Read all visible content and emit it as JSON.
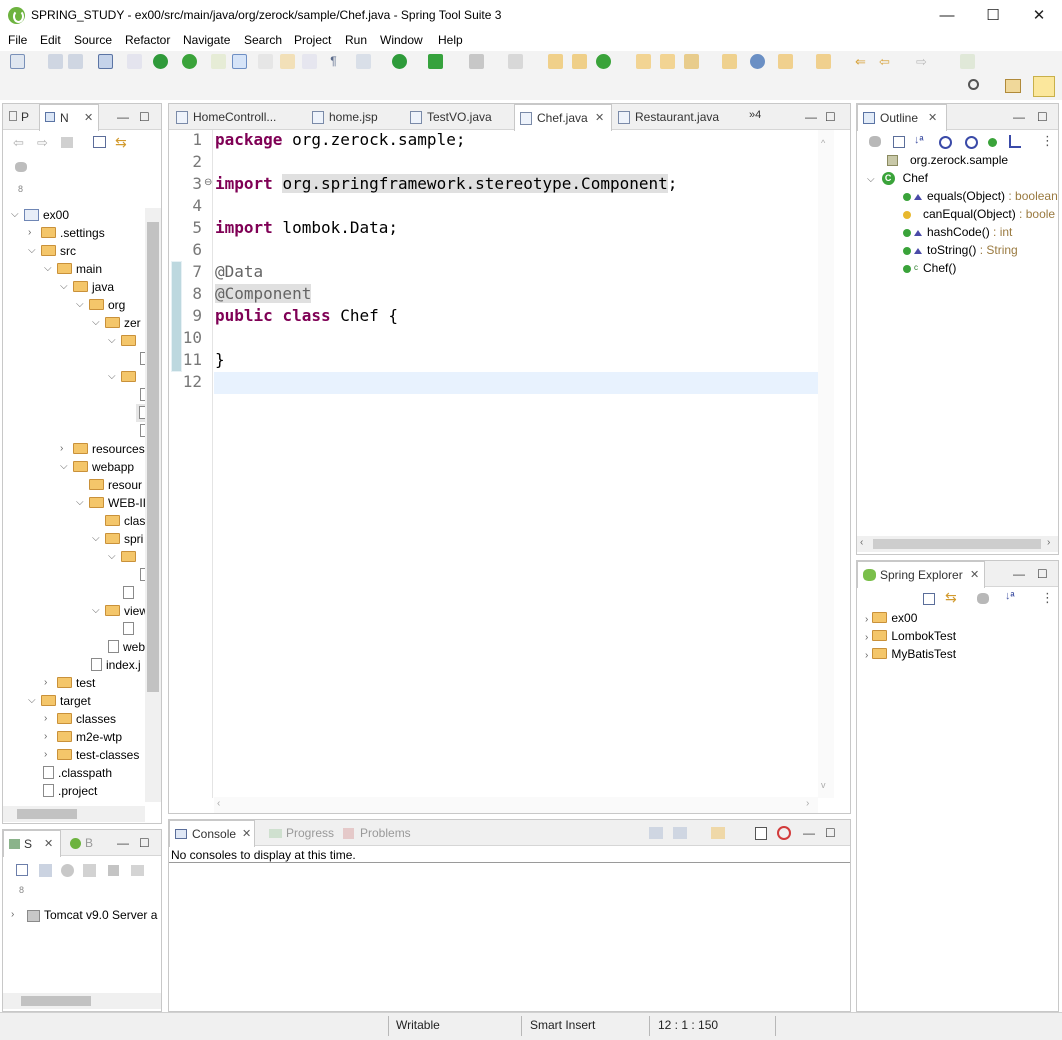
{
  "window": {
    "title": "SPRING_STUDY - ex00/src/main/java/org/zerock/sample/Chef.java - Spring Tool Suite 3",
    "minimize": "—",
    "maximize": "☐",
    "close": "✕"
  },
  "menu": [
    "File",
    "Edit",
    "Source",
    "Refactor",
    "Navigate",
    "Search",
    "Project",
    "Run",
    "Window",
    "Help"
  ],
  "left_panel": {
    "tabs": [
      "P",
      "N"
    ],
    "tree": [
      {
        "label": "ex00"
      },
      {
        "label": ".settings"
      },
      {
        "label": "src"
      },
      {
        "label": "main"
      },
      {
        "label": "java"
      },
      {
        "label": "org"
      },
      {
        "label": "zer"
      },
      {
        "label": "resources"
      },
      {
        "label": "webapp"
      },
      {
        "label": "resour"
      },
      {
        "label": "WEB-II"
      },
      {
        "label": "clas"
      },
      {
        "label": "spri"
      },
      {
        "label": "view"
      },
      {
        "label": "web"
      },
      {
        "label": "index.j"
      },
      {
        "label": "test"
      },
      {
        "label": "target"
      },
      {
        "label": "classes"
      },
      {
        "label": "m2e-wtp"
      },
      {
        "label": "test-classes"
      },
      {
        "label": ".classpath"
      },
      {
        "label": ".project"
      }
    ]
  },
  "servers_panel": {
    "tabs": [
      "S",
      "B"
    ],
    "server": "Tomcat v9.0 Server a"
  },
  "editor": {
    "tabs": [
      {
        "label": "HomeControll..."
      },
      {
        "label": "home.jsp"
      },
      {
        "label": "TestVO.java"
      },
      {
        "label": "Chef.java",
        "active": true
      },
      {
        "label": "Restaurant.java"
      }
    ],
    "overflow": "»4",
    "line_numbers": [
      "1",
      "2",
      "3",
      "4",
      "5",
      "6",
      "7",
      "8",
      "9",
      "10",
      "11",
      "12"
    ],
    "code": {
      "l1_kw": "package",
      "l1_rest": " org.zerock.sample;",
      "l3_kw": "import",
      "l3_rest": "org.springframework.stereotype.Component",
      "l3_end": ";",
      "l5_kw": "import",
      "l5_rest": " lombok.Data;",
      "l7": "@Data",
      "l8": "@Component",
      "l9_kw1": "public",
      "l9_kw2": "class",
      "l9_rest": " Chef {",
      "l11": "}"
    }
  },
  "console": {
    "tabs": [
      "Console",
      "Progress",
      "Problems"
    ],
    "message": "No consoles to display at this time."
  },
  "outline": {
    "title": "Outline",
    "package": "org.zerock.sample",
    "class": "Chef",
    "members": [
      {
        "name": "equals(Object)",
        "type": " : boolean"
      },
      {
        "name": "canEqual(Object)",
        "type": " : boole"
      },
      {
        "name": "hashCode()",
        "type": " : int"
      },
      {
        "name": "toString()",
        "type": " : String"
      },
      {
        "name": "Chef()",
        "type": ""
      }
    ]
  },
  "spring_explorer": {
    "title": "Spring Explorer",
    "items": [
      "ex00",
      "LombokTest",
      "MyBatisTest"
    ]
  },
  "status": {
    "writable": "Writable",
    "insert": "Smart Insert",
    "position": "12 : 1 : 150"
  }
}
